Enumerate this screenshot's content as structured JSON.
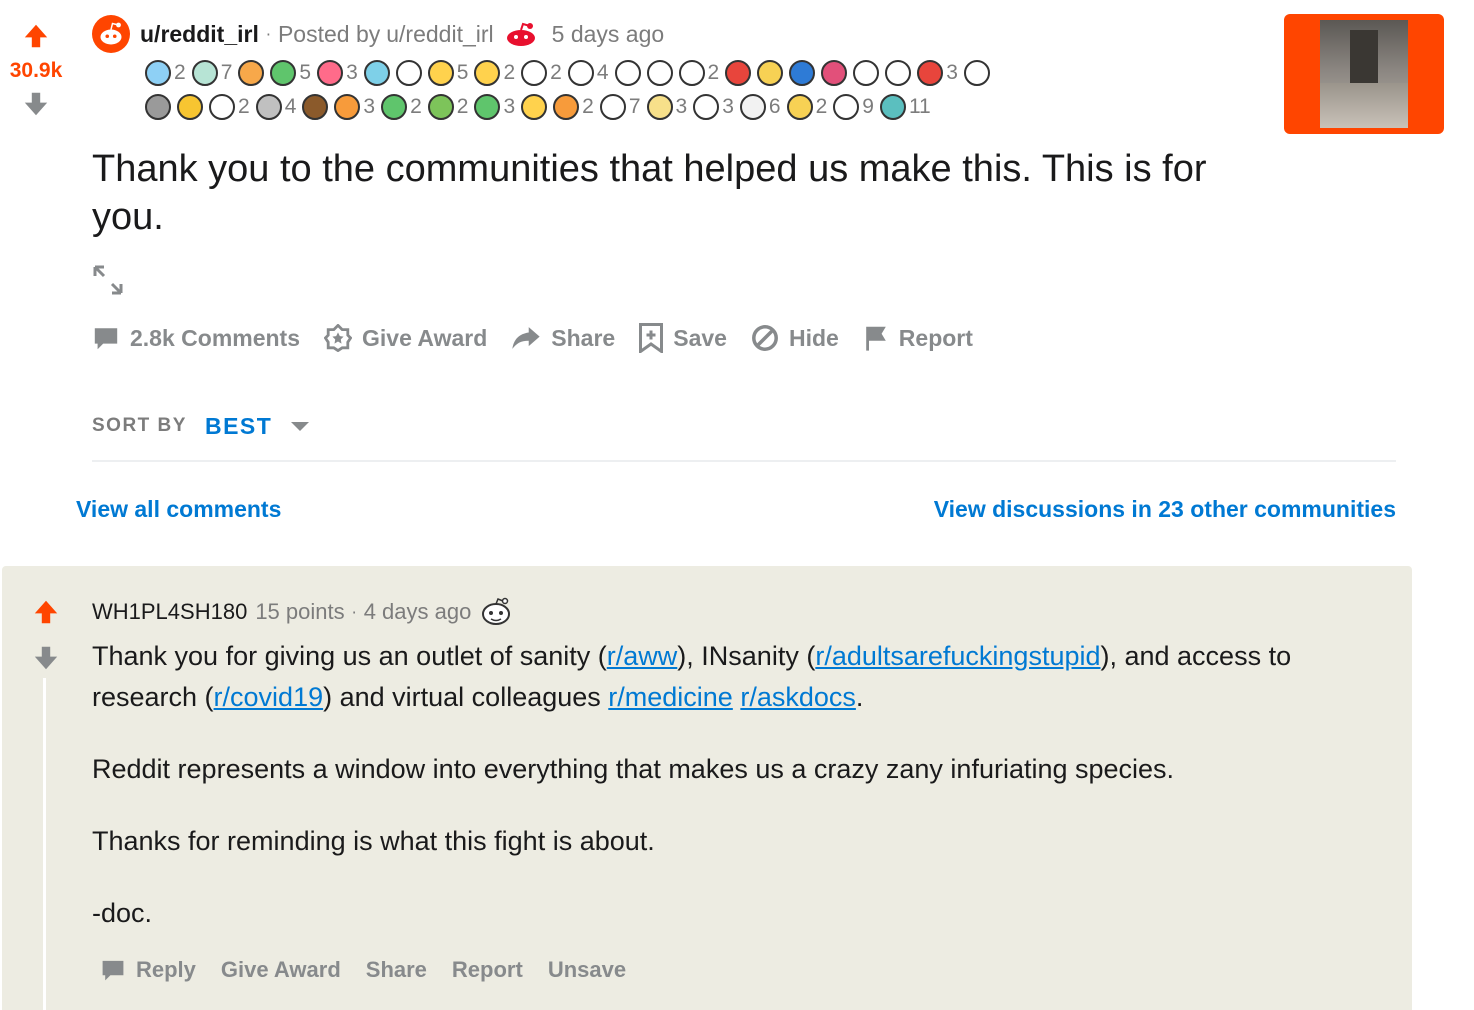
{
  "post": {
    "score": "30.9k",
    "subreddit": "u/reddit_irl",
    "posted_by_prefix": "Posted by",
    "posted_by_user": "u/reddit_irl",
    "time": "5 days ago",
    "title": "Thank you to the communities that helped us make this. This is for you.",
    "awards_row1": [
      {
        "icon": "diamond-award-icon",
        "count": "2",
        "color": "#8ed0f5"
      },
      {
        "icon": "platinum-award-icon",
        "count": "7",
        "color": "#b7e4d5"
      },
      {
        "icon": "rainbow-award-icon",
        "count": "",
        "color": "#f7a84a"
      },
      {
        "icon": "frog-award-icon",
        "count": "5",
        "color": "#5fc56c"
      },
      {
        "icon": "heart-eyes-award-icon",
        "count": "3",
        "color": "#ff6b8a"
      },
      {
        "icon": "wave-award-icon",
        "count": "",
        "color": "#7ed0e8"
      },
      {
        "icon": "snoo-head-award-icon",
        "count": "",
        "color": "#ffffff"
      },
      {
        "icon": "star-award-icon",
        "count": "5",
        "color": "#ffd24d"
      },
      {
        "icon": "clap-award-icon",
        "count": "2",
        "color": "#ffd24d"
      },
      {
        "icon": "skull-award-icon",
        "count": "2",
        "color": "#ffffff"
      },
      {
        "icon": "snoo-hat-award-icon",
        "count": "4",
        "color": "#ffffff"
      },
      {
        "icon": "balloon-award-icon",
        "count": "",
        "color": "#ffffff"
      },
      {
        "icon": "hands-award-icon",
        "count": "",
        "color": "#ffffff"
      },
      {
        "icon": "unicorn-award-icon",
        "count": "2",
        "color": "#ffffff"
      },
      {
        "icon": "gift-award-icon",
        "count": "",
        "color": "#e8453c"
      },
      {
        "icon": "2020-glasses-award-icon",
        "count": "",
        "color": "#f7d154"
      },
      {
        "icon": "book-award-icon",
        "count": "",
        "color": "#2e7bd6"
      },
      {
        "icon": "gem-heart-award-icon",
        "count": "",
        "color": "#e2507a"
      },
      {
        "icon": "chef-award-icon",
        "count": "",
        "color": "#ffffff"
      },
      {
        "icon": "surprised-award-icon",
        "count": "",
        "color": "#ffffff"
      },
      {
        "icon": "kiss-award-icon",
        "count": "3",
        "color": "#e8453c"
      },
      {
        "icon": "snoo-party-award-icon",
        "count": "",
        "color": "#ffffff"
      }
    ],
    "awards_row2": [
      {
        "icon": "stonks-award-icon",
        "count": "",
        "color": "#9a9a9a"
      },
      {
        "icon": "trophy-award-icon",
        "count": "",
        "color": "#f7c531"
      },
      {
        "icon": "smirk-award-icon",
        "count": "2",
        "color": "#ffffff"
      },
      {
        "icon": "silver-coin-award-icon",
        "count": "4",
        "color": "#c0c0c0"
      },
      {
        "icon": "bear-award-icon",
        "count": "",
        "color": "#8b5a2b"
      },
      {
        "icon": "monkey-award-icon",
        "count": "3",
        "color": "#f79b3b"
      },
      {
        "icon": "gecko-award-icon",
        "count": "2",
        "color": "#5fc56c"
      },
      {
        "icon": "salad-award-icon",
        "count": "2",
        "color": "#7dc45a"
      },
      {
        "icon": "cactus-award-icon",
        "count": "3",
        "color": "#5fc56c"
      },
      {
        "icon": "sun-award-icon",
        "count": "",
        "color": "#ffd24d"
      },
      {
        "icon": "fire-award-icon",
        "count": "2",
        "color": "#f79b3b"
      },
      {
        "icon": "snoo-award-icon",
        "count": "7",
        "color": "#ffffff"
      },
      {
        "icon": "todo-list-award-icon",
        "count": "3",
        "color": "#f7e08a"
      },
      {
        "icon": "snoo-shades-award-icon",
        "count": "3",
        "color": "#ffffff"
      },
      {
        "icon": "notebook-award-icon",
        "count": "6",
        "color": "#f2f2f2"
      },
      {
        "icon": "board-game-award-icon",
        "count": "2",
        "color": "#f7d154"
      },
      {
        "icon": "door-award-icon",
        "count": "9",
        "color": "#ffffff"
      },
      {
        "icon": "globe-award-icon",
        "count": "11",
        "color": "#5bbfbf"
      }
    ],
    "actions": {
      "comments": "2.8k Comments",
      "give_award": "Give Award",
      "share": "Share",
      "save": "Save",
      "hide": "Hide",
      "report": "Report"
    }
  },
  "sort": {
    "label": "SORT BY",
    "value": "BEST"
  },
  "links": {
    "view_all": "View all comments",
    "view_discussions": "View discussions in 23 other communities"
  },
  "comment": {
    "author": "WH1PL4SH180",
    "points": "15 points",
    "time": "4 days ago",
    "award_icon": "snoo-head-award-icon",
    "p1_a": "Thank you for giving us an outlet of sanity (",
    "p1_link1": "r/aww",
    "p1_b": "), INsanity (",
    "p1_link2": "r/adultsarefuckingstupid",
    "p1_c": "), and access to research (",
    "p1_link3": "r/covid19",
    "p1_d": ") and virtual colleagues ",
    "p1_link4": "r/medicine",
    "p1_e": " ",
    "p1_link5": "r/askdocs",
    "p1_f": ".",
    "p2": "Reddit represents a window into everything that makes us a crazy zany infuriating species.",
    "p3": "Thanks for reminding is what this fight is about.",
    "p4": "-doc.",
    "actions": {
      "reply": "Reply",
      "give_award": "Give Award",
      "share": "Share",
      "report": "Report",
      "unsave": "Unsave"
    }
  },
  "colors": {
    "upvote": "#ff4500",
    "downvote_inactive": "#878a8c",
    "link": "#0079d3",
    "comment_bg": "#edece2"
  }
}
